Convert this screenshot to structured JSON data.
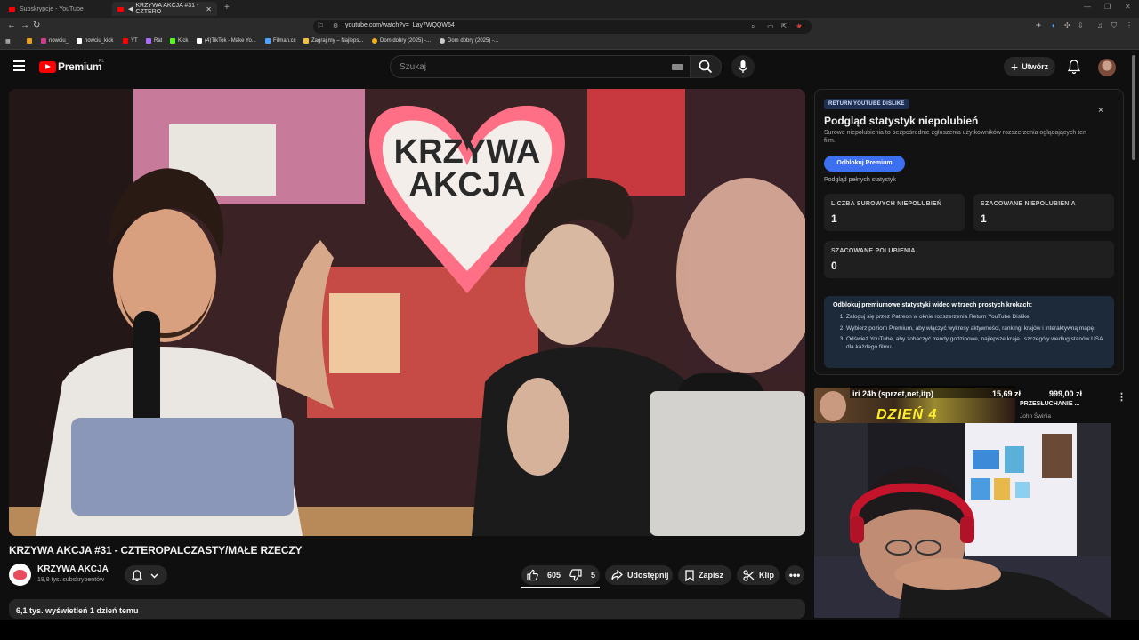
{
  "browser": {
    "tabs": [
      {
        "title": "Subskrypcje - YouTube",
        "active": false
      },
      {
        "title": "KRZYWA AKCJA #31 - CZTERO",
        "active": true
      }
    ],
    "new_tab": "+",
    "url": "youtube.com/watch?v=_Lay7WQQW64",
    "bookmarks": [
      {
        "label": "",
        "color": "#e8a020"
      },
      {
        "label": "nowciu_",
        "color": "#d03c8c"
      },
      {
        "label": "nowciu_kick",
        "color": "#ffffff"
      },
      {
        "label": "YT",
        "color": "#ff0000"
      },
      {
        "label": "Rat",
        "color": "#a86cff"
      },
      {
        "label": "Kick",
        "color": "#53fc18"
      },
      {
        "label": "(4)TikTok - Make Yo...",
        "color": "#ffffff"
      },
      {
        "label": "Filman.cc",
        "color": "#4da3ff"
      },
      {
        "label": "Zagraj.my – Najleps...",
        "color": "#f0c040"
      },
      {
        "label": "Dom dobry (2025) -...",
        "color": "#f0b020"
      },
      {
        "label": "Dom dobry (2025) -...",
        "color": "#cccccc"
      }
    ]
  },
  "header": {
    "logo_text": "Premium",
    "region": "PL",
    "search_placeholder": "Szukaj",
    "create_label": "Utwórz"
  },
  "video": {
    "title": "KRZYWA AKCJA #31 - CZTEROPALCZASTY/MAŁE RZECZY",
    "channel": "KRZYWA AKCJA",
    "subscribers": "18,8 tys. subskrybentów",
    "likes": "605",
    "dislikes": "5",
    "share_label": "Udostępnij",
    "save_label": "Zapisz",
    "clip_label": "Klip",
    "views_line": "6,1 tys. wyświetleń  1 dzień temu",
    "scene_sign": "KRZYWA AKCJA"
  },
  "ryd": {
    "badge": "RETURN YOUTUBE DISLIKE",
    "close": "×",
    "title": "Podgląd statystyk niepolubień",
    "description": "Surowe niepolubienia to bezpośrednie zgłoszenia użytkowników rozszerzenia oglądających ten film.",
    "unlock_button": "Odblokuj Premium",
    "full_preview": "Podgląd pełnych statystyk",
    "stats": [
      {
        "label": "LICZBA SUROWYCH NIEPOLUBIEŃ",
        "value": "1"
      },
      {
        "label": "SZACOWANE NIEPOLUBIENIA",
        "value": "1"
      },
      {
        "label": "SZACOWANE POLUBIENIA",
        "value": "0"
      }
    ],
    "steps_title": "Odblokuj premiumowe statystyki wideo w trzech prostych krokach:",
    "steps": [
      "Zaloguj się przez Patreon w oknie rozszerzenia Return YouTube Dislike.",
      "Wybierz poziom Premium, aby włączyć wykresy aktywności, rankingi krajów i interaktywną mapę.",
      "Odśwież YouTube, aby zobaczyć trendy godzinowe, najlepsze kraje i szczegóły według stanów USA dla każdego filmu."
    ]
  },
  "recommendation": {
    "overlay_text": "iri 24h (sprzet,net,itp)",
    "price1": "15,69 zł",
    "price2": "999,00 zł",
    "thumb_big": "DZIEŃ 4",
    "title": "PRZESŁUCHANIE ...",
    "channel": "John Świnia"
  },
  "colors": {
    "accent_blue": "#3d6ff1",
    "yt_red": "#ff0000",
    "background": "#0f0f0f"
  }
}
